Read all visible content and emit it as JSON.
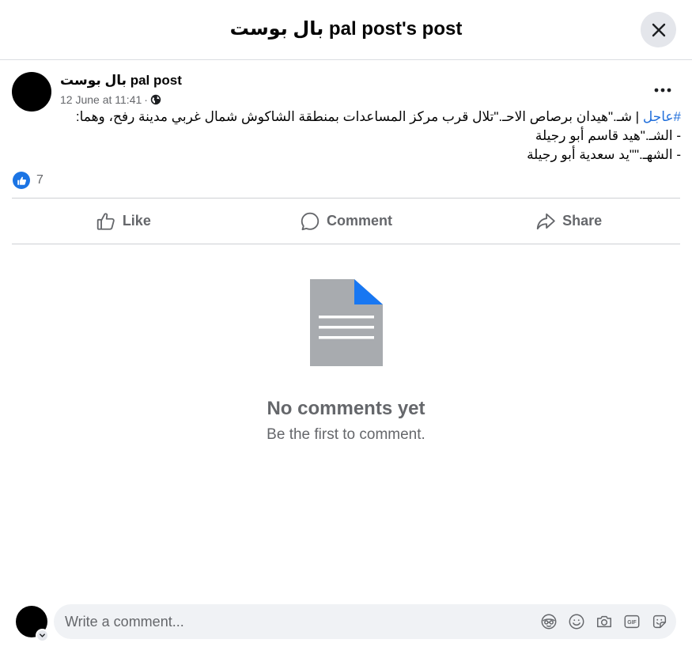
{
  "header": {
    "title": "بال بوست pal post's post",
    "close_icon": "close-icon"
  },
  "post": {
    "author": "بال بوست pal post",
    "date": "12 June at 11:41",
    "separator": "·",
    "privacy_icon": "globe-icon",
    "more_icon": "more-horizontal-icon",
    "hashtag": "#عاجل",
    "line1_rest": " | شـ.\"هيدان برصاص الاحـ.\"تلال  قرب مركز المساعدات بمنطقة الشاكوش شمال غربي مدينة رفح، وهما:",
    "line2": "- الشـ.\"هيد قاسم أبو رجيلة",
    "line3": "- الشهـ.\"\"يد سعدية أبو رجيلة",
    "reaction_icon": "like-reaction-icon",
    "reaction_count": "7"
  },
  "actions": {
    "like": {
      "label": "Like",
      "icon": "thumbs-up-icon"
    },
    "comment": {
      "label": "Comment",
      "icon": "comment-bubble-icon"
    },
    "share": {
      "label": "Share",
      "icon": "share-arrow-icon"
    }
  },
  "empty_state": {
    "icon": "document-icon",
    "title": "No comments yet",
    "subtitle": "Be the first to comment."
  },
  "composer": {
    "placeholder": "Write a comment...",
    "tools": [
      "avatar-sticker-icon",
      "emoji-icon",
      "camera-icon",
      "gif-icon",
      "sticker-icon"
    ]
  },
  "colors": {
    "accent": "#1b74e4",
    "hashtag": "#216fdb",
    "secondary_text": "#65676b",
    "doc_gray": "#a8abaf",
    "doc_corner": "#1877f2"
  }
}
